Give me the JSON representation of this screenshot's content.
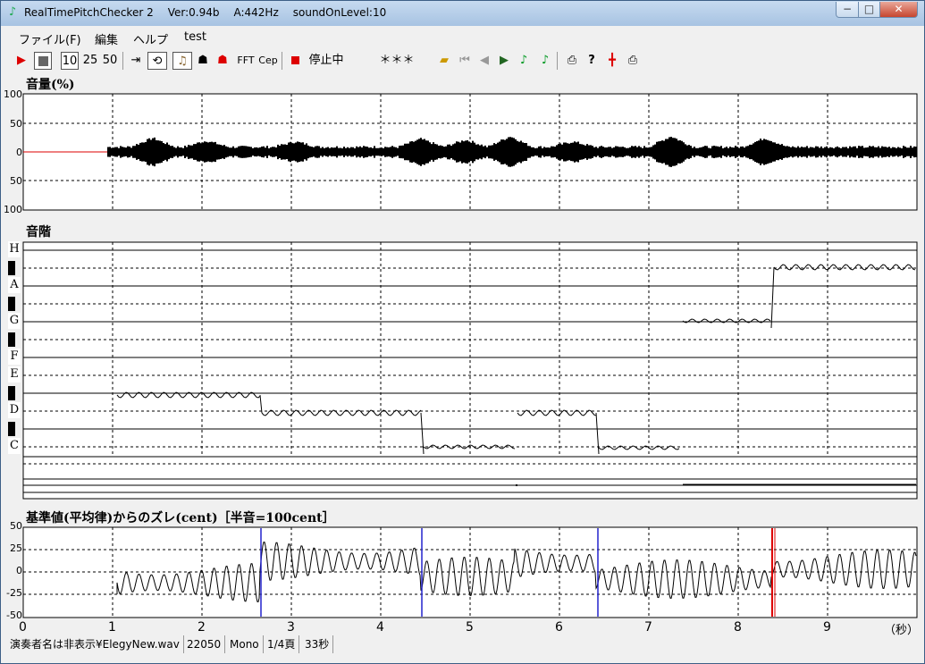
{
  "window": {
    "app_name": "RealTimePitchChecker 2",
    "version": "Ver:0.94b",
    "tuning": "A:442Hz",
    "sound_level": "soundOnLevel:10",
    "minimize": "−",
    "maximize": "□",
    "close": "✕"
  },
  "menu": {
    "items": [
      "ファイル(F)",
      "編集",
      "ヘルプ",
      "test"
    ]
  },
  "toolbar": {
    "range_10": "10",
    "range_25": "25",
    "range_50": "50",
    "fft": "FFT",
    "cep": "Cep",
    "status": "停止中",
    "stars": "＊＊＊",
    "icons": [
      "play-icon",
      "stop-icon",
      "skip-end-icon",
      "loop-icon",
      "violin-icon",
      "person-icon",
      "red-person-icon",
      "record-icon",
      "open-folder-icon",
      "first-icon",
      "prev-icon",
      "next-icon",
      "note-icon",
      "note-icon-2",
      "print-icon",
      "help-icon",
      "marker-icon",
      "print-icon-2"
    ]
  },
  "volume_panel": {
    "title": "音量(%)",
    "ticks": [
      "100",
      "50",
      "0",
      "50",
      "100"
    ]
  },
  "scale_panel": {
    "title": "音階",
    "notes": [
      "H",
      "A",
      "G",
      "F",
      "E",
      "D",
      "C"
    ]
  },
  "cent_panel": {
    "title": "基準値(平均律)からのズレ(cent)［半音=100cent］",
    "ticks": [
      "50",
      "25",
      "0",
      "-25",
      "-50"
    ]
  },
  "x_axis": {
    "ticks": [
      "0",
      "1",
      "2",
      "3",
      "4",
      "5",
      "6",
      "7",
      "8",
      "9"
    ],
    "unit": "（秒）"
  },
  "status_bar": {
    "file": "演奏者名は非表示¥ElegyNew.wav",
    "rate": "22050",
    "channels": "Mono",
    "page": "1/4頁",
    "length": "33秒"
  }
}
